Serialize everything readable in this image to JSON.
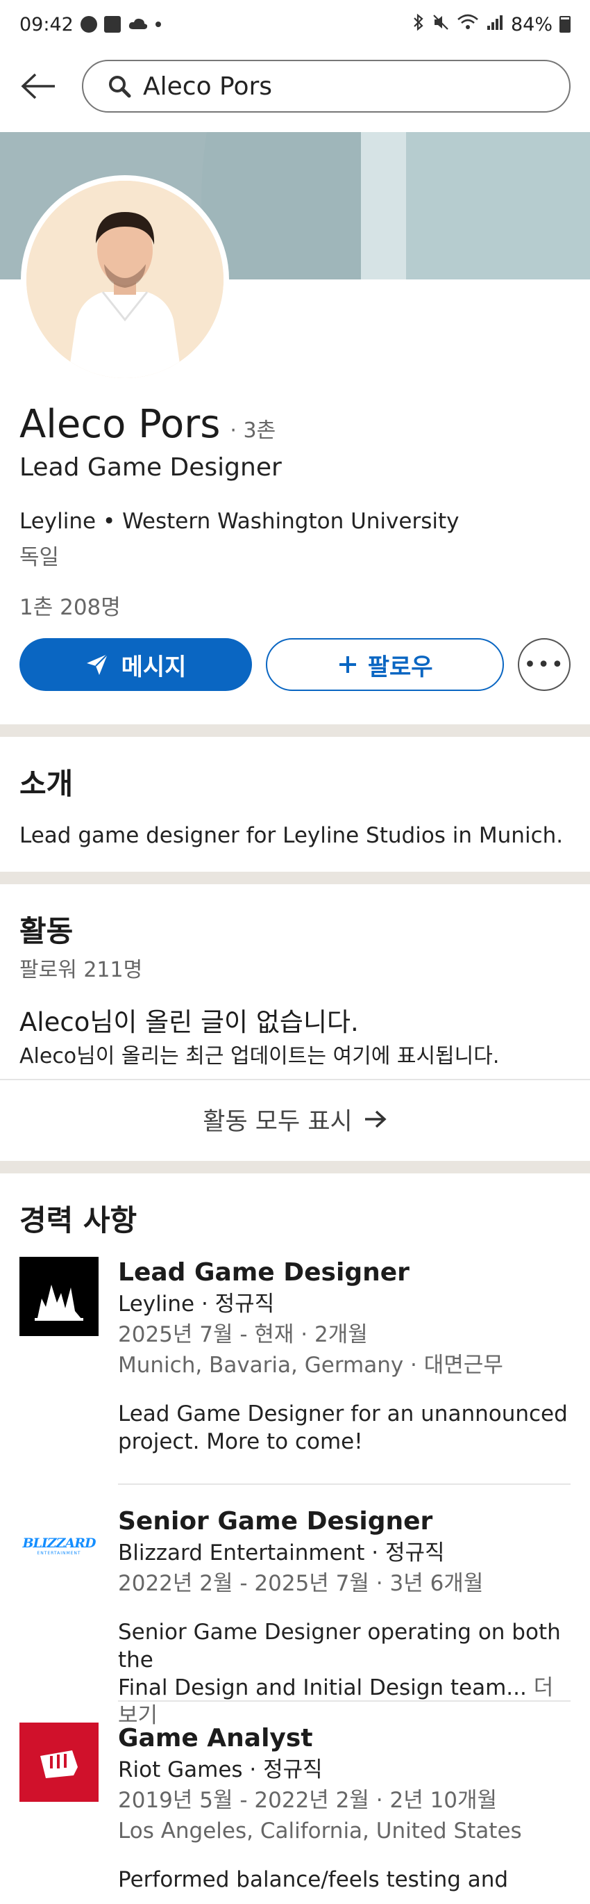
{
  "status_bar": {
    "time": "09:42",
    "battery": "84%"
  },
  "search": {
    "value": "Aleco Pors"
  },
  "profile": {
    "name": "Aleco Pors",
    "degree": "· 3촌",
    "headline": "Lead Game Designer",
    "org_line": "Leyline • Western Washington University",
    "location": "독일",
    "connections": "1촌 208명"
  },
  "actions": {
    "message_label": "메시지",
    "follow_label": "팔로우",
    "more_label": "•••"
  },
  "about": {
    "title": "소개",
    "text": "Lead game designer for Leyline Studios in Munich."
  },
  "activity": {
    "title": "활동",
    "followers": "팔로워 211명",
    "no_posts": "Aleco님이 올린 글이 없습니다.",
    "no_posts_sub": "Aleco님이 올리는 최근 업데이트는 여기에 표시됩니다.",
    "show_all": "활동 모두 표시"
  },
  "experience": {
    "title": "경력 사항",
    "items": [
      {
        "title": "Lead Game Designer",
        "company": "Leyline · 정규직",
        "dates": "2025년 7월 - 현재 · 2개월",
        "location": "Munich, Bavaria, Germany · 대면근무",
        "description": "Lead Game Designer for an unannounced project. More to come!",
        "logo_text": ""
      },
      {
        "title": "Senior Game Designer",
        "company": "Blizzard Entertainment · 정규직",
        "dates": "2022년 2월 - 2025년 7월 · 3년 6개월",
        "description_line1": "Senior Game Designer operating on both the",
        "description_line2": "Final Design and Initial Design team...",
        "see_more": " 더 보기",
        "logo_text": "BLIZZARD",
        "logo_subtext": "ENTERTAINMENT"
      },
      {
        "title": "Game Analyst",
        "company": "Riot Games · 정규직",
        "dates": "2019년 5월 - 2022년 2월 · 2년 10개월",
        "location": "Los Angeles, California, United States",
        "description": "Performed balance/feels testing and"
      }
    ]
  },
  "colors": {
    "primary": "#0a66c2",
    "divider": "#e9e5df",
    "riot_red": "#d0112b",
    "blizzard_blue": "#148eff"
  }
}
